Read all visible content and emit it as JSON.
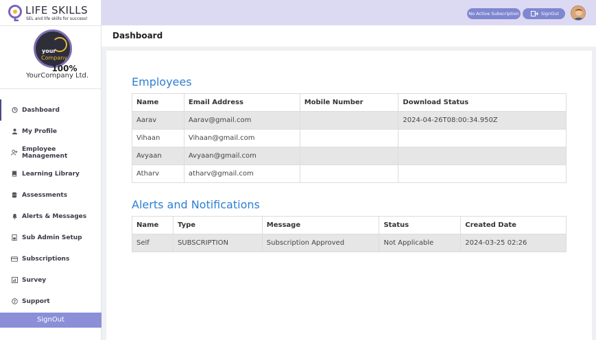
{
  "brand": {
    "name": "LIFE SKILLS",
    "tagline": "SEL and life skills for success!"
  },
  "profile": {
    "logo_word_1": "your",
    "logo_word_2": "Company",
    "progress": "100%",
    "company_name": "YourCompany Ltd."
  },
  "sidebar": {
    "items": [
      {
        "label": "Dashboard",
        "icon": "clock-icon"
      },
      {
        "label": "My Profile",
        "icon": "user-icon"
      },
      {
        "label": "Employee Management",
        "icon": "user-plus-icon"
      },
      {
        "label": "Learning Library",
        "icon": "book-icon"
      },
      {
        "label": "Assessments",
        "icon": "database-icon"
      },
      {
        "label": "Alerts & Messages",
        "icon": "bell-icon"
      },
      {
        "label": "Sub Admin Setup",
        "icon": "document-icon"
      },
      {
        "label": "Subscriptions",
        "icon": "card-icon"
      },
      {
        "label": "Survey",
        "icon": "chart-icon"
      },
      {
        "label": "Support",
        "icon": "question-icon"
      }
    ],
    "signout_label": "SignOut"
  },
  "topbar": {
    "subscription_label": "No Active Subscription",
    "signout_label": "SignOut"
  },
  "header": {
    "title": "Dashboard"
  },
  "employees": {
    "title": "Employees",
    "columns": [
      "Name",
      "Email Address",
      "Mobile Number",
      "Download Status"
    ],
    "rows": [
      [
        "Aarav",
        "Aarav@gmail.com",
        "",
        "2024-04-26T08:00:34.950Z"
      ],
      [
        "Vihaan",
        "Vihaan@gmail.com",
        "",
        ""
      ],
      [
        "Avyaan",
        "Avyaan@gmail.com",
        "",
        ""
      ],
      [
        "Atharv",
        "atharv@gmail.com",
        "",
        ""
      ]
    ]
  },
  "alerts": {
    "title": "Alerts and Notifications",
    "columns": [
      "Name",
      "Type",
      "Message",
      "Status",
      "Created Date"
    ],
    "rows": [
      [
        "Self",
        "SUBSCRIPTION",
        "Subscription Approved",
        "Not Applicable",
        "2024-03-25 02:26"
      ]
    ]
  },
  "colors": {
    "accent": "#2d7fd1",
    "topbar": "#dcdaf3",
    "pill": "#7f87d0",
    "signout": "#8a8fd8"
  }
}
